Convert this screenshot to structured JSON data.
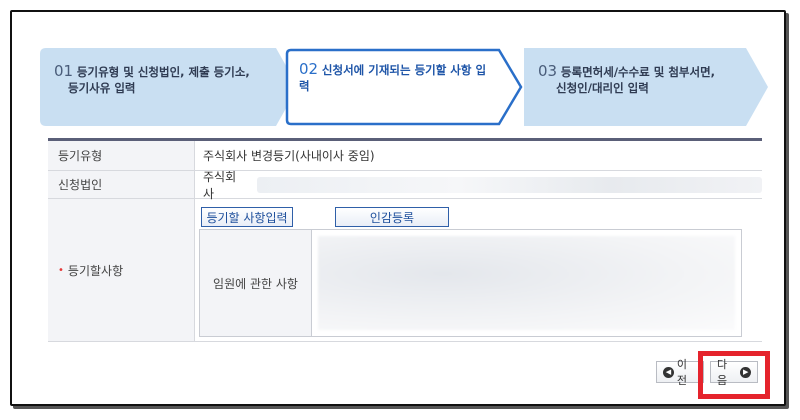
{
  "steps": [
    {
      "num": "01",
      "line1": "등기유형 및 신청법인, 제출 등기소,",
      "line2": "등기사유 입력"
    },
    {
      "num": "02",
      "line1": "신청서에 기재되는 등기할 사항 입력",
      "line2": ""
    },
    {
      "num": "03",
      "line1": "등록면허세/수수료 및 첨부서면,",
      "line2": "신청인/대리인 입력"
    }
  ],
  "table": {
    "row1": {
      "label": "등기유형",
      "value": "주식회사 변경등기(사내이사 중임)"
    },
    "row2": {
      "label": "신청법인",
      "value": "주식회사"
    },
    "row3": {
      "required_mark": "•",
      "label": "등기할사항",
      "tab_input": "등기할 사항입력",
      "tab_seal": "인감등록",
      "sub_label": "임원에 관한 사항"
    }
  },
  "buttons": {
    "prev": "이전",
    "next": "다음"
  },
  "colors": {
    "accent": "#2a6fc9",
    "highlight": "#e5232c",
    "table_top": "#5a5f78"
  }
}
